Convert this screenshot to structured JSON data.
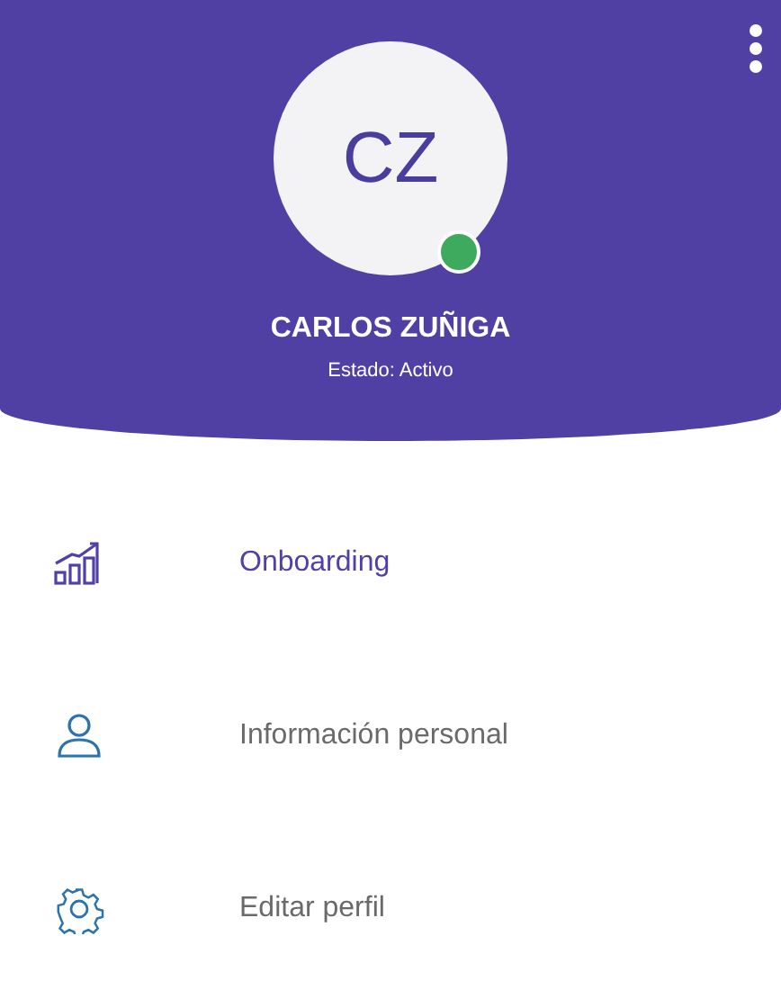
{
  "profile": {
    "initials": "CZ",
    "status_dot": {
      "color": "#3daa5e"
    },
    "name": "CARLOS ZUÑIGA",
    "status": "Estado: Activo"
  },
  "menu": [
    {
      "kind": "chart",
      "label": "Onboarding",
      "selected": true
    },
    {
      "kind": "person",
      "label": "Información personal",
      "selected": false
    },
    {
      "kind": "gear",
      "label": "Editar perfil",
      "selected": false
    }
  ]
}
